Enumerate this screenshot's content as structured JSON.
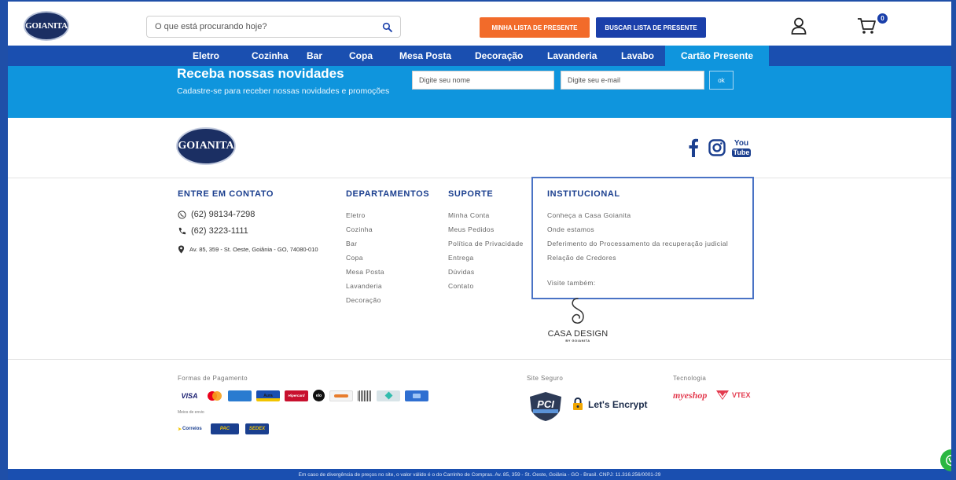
{
  "header": {
    "logo_text": "GOIANITA",
    "search_placeholder": "O que está procurando hoje?",
    "btn_minha_lista": "MINHA LISTA DE PRESENTE",
    "btn_buscar_lista": "BUSCAR LISTA DE PRESENTE",
    "cart_count": "0"
  },
  "nav": {
    "items": [
      "Eletro",
      "Cozinha",
      "Bar",
      "Copa",
      "Mesa Posta",
      "Decoração",
      "Lavanderia",
      "Lavabo",
      "Cartão Presente"
    ]
  },
  "newsletter": {
    "title": "Receba nossas novidades",
    "subtitle": "Cadastre-se para receber nossas novidades e promoções",
    "name_placeholder": "Digite seu nome",
    "email_placeholder": "Digite seu e-mail",
    "ok_label": "ok"
  },
  "footer": {
    "logo_text": "GOIANITA",
    "contact": {
      "title": "ENTRE EM CONTATO",
      "whatsapp": "(62) 98134-7298",
      "phone": "(62) 3223-1111",
      "address": "Av. 85, 359 - St. Oeste, Goiânia - GO, 74080-010"
    },
    "departamentos": {
      "title": "DEPARTAMENTOS",
      "links": [
        "Eletro",
        "Cozinha",
        "Bar",
        "Copa",
        "Mesa Posta",
        "Lavanderia",
        "Decoração"
      ]
    },
    "suporte": {
      "title": "SUPORTE",
      "links": [
        "Minha Conta",
        "Meus Pedidos",
        "Política de Privacidade",
        "Entrega",
        "Dúvidas",
        "Contato"
      ]
    },
    "institucional": {
      "title": "INSTITUCIONAL",
      "links": [
        "Conheça a Casa Goianita",
        "Onde estamos",
        "Deferimento do Processamento da recuperação judicial",
        "Relação de Credores"
      ],
      "visite": "Visite também:"
    },
    "casa_design": {
      "name": "CASA DESIGN",
      "sub": "BY GOIANITA"
    },
    "payment_label": "Formas de Pagamento",
    "shipping_label": "Meios de envio",
    "secure_label": "Site Seguro",
    "tech_label": "Tecnologia",
    "cards": {
      "visa": "VISA",
      "aura": "Aura",
      "hipercard": "Hipercard",
      "elo": "elo"
    },
    "shipping": {
      "correios": "Correios",
      "pac": "PAC",
      "sedex": "SEDEX"
    },
    "letsencrypt": "Let's Encrypt",
    "myeshop": "myeshop",
    "vtex": "VTEX",
    "youtube_top": "You",
    "youtube_bottom": "Tube",
    "disclaimer": "Em caso de divergência de preços no site, o valor válido é o do Carrinho de Compras. Av. 85, 359 - St. Oeste, Goiânia - GO - Brasil. CNPJ: 11.316.256/0001-29"
  },
  "colors": {
    "brand_blue": "#1a4fb0",
    "light_blue": "#0f95dd",
    "orange": "#f26b2a"
  }
}
